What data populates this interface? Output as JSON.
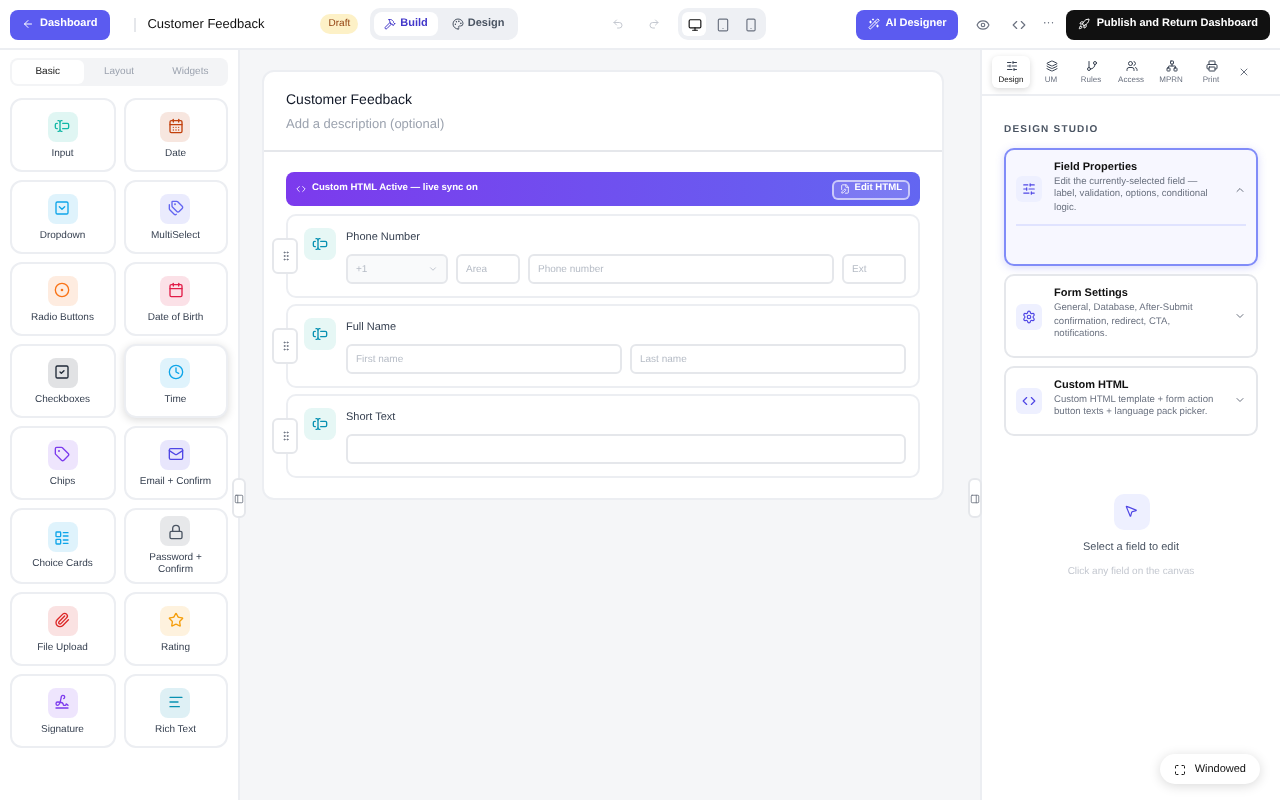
{
  "topbar": {
    "back_button": "Dashboard",
    "title": "Customer Feedback",
    "status_badge": "Draft",
    "mode_tabs": [
      {
        "label": "Build",
        "selected": true
      },
      {
        "label": "Design",
        "selected": false
      }
    ],
    "devices": [
      {
        "kind": "desktop",
        "selected": true
      },
      {
        "kind": "tablet",
        "selected": false
      },
      {
        "kind": "phone",
        "selected": false
      }
    ],
    "ai_button": "AI Designer",
    "more": "···",
    "publish_button": "Publish and Return Dashboard"
  },
  "palette": {
    "tabs": [
      {
        "label": "Basic",
        "selected": true
      },
      {
        "label": "Layout",
        "selected": false
      },
      {
        "label": "Widgets",
        "selected": false
      }
    ],
    "items": [
      {
        "label": "Input",
        "kind": "input",
        "color": "#14b8a6",
        "selected": false
      },
      {
        "label": "Date",
        "kind": "date",
        "color": "#c2410c",
        "selected": false
      },
      {
        "label": "Dropdown",
        "kind": "dropdown",
        "color": "#0ea5e9",
        "selected": false
      },
      {
        "label": "MultiSelect",
        "kind": "tags",
        "color": "#6366f1",
        "selected": false
      },
      {
        "label": "Radio Buttons",
        "kind": "radio",
        "color": "#f97316",
        "selected": false
      },
      {
        "label": "Date of Birth",
        "kind": "calendar",
        "color": "#e11d48",
        "selected": false
      },
      {
        "label": "Checkboxes",
        "kind": "checkbox",
        "color": "#1f2937",
        "selected": false
      },
      {
        "label": "Time",
        "kind": "time",
        "color": "#0ea5e9",
        "selected": true
      },
      {
        "label": "Chips",
        "kind": "chips",
        "color": "#7c3aed",
        "selected": false
      },
      {
        "label": "Email + Confirm",
        "kind": "email",
        "color": "#4f46e5",
        "selected": false
      },
      {
        "label": "Choice Cards",
        "kind": "cards",
        "color": "#0ea5e9",
        "selected": false
      },
      {
        "label": "Password + Confirm",
        "kind": "lock",
        "color": "#4b5563",
        "selected": false
      },
      {
        "label": "File Upload",
        "kind": "file",
        "color": "#dc2626",
        "selected": false
      },
      {
        "label": "Rating",
        "kind": "star",
        "color": "#f59e0b",
        "selected": false
      },
      {
        "label": "Signature",
        "kind": "signature",
        "color": "#7c3aed",
        "selected": false
      },
      {
        "label": "Rich Text",
        "kind": "richtext",
        "color": "#0891b2",
        "selected": false
      }
    ]
  },
  "canvas": {
    "form_title": "Customer Feedback",
    "description_placeholder": "Add a description (optional)",
    "banner": {
      "text": "Custom HTML Active — live sync on",
      "button": "Edit HTML"
    },
    "fields": [
      {
        "label": "Phone Number",
        "inputs": [
          {
            "kind": "select",
            "placeholder": "+1"
          },
          {
            "kind": "text",
            "placeholder": "Area"
          },
          {
            "kind": "wide",
            "placeholder": "Phone number"
          },
          {
            "kind": "text",
            "placeholder": "Ext"
          }
        ]
      },
      {
        "label": "Full Name",
        "inputs": [
          {
            "kind": "wide",
            "placeholder": "First name"
          },
          {
            "kind": "wide",
            "placeholder": "Last name"
          }
        ]
      },
      {
        "label": "Short Text",
        "inputs": [
          {
            "kind": "wide"
          }
        ]
      }
    ]
  },
  "panel": {
    "tabs": [
      {
        "label": "Design",
        "kind": "sliders",
        "selected": true
      },
      {
        "label": "UM",
        "kind": "stack",
        "selected": false
      },
      {
        "label": "Rules",
        "kind": "branch",
        "selected": false
      },
      {
        "label": "Access",
        "kind": "users",
        "selected": false
      },
      {
        "label": "MPRN",
        "kind": "network",
        "selected": false
      },
      {
        "label": "Print",
        "kind": "print",
        "selected": false
      }
    ],
    "heading": "DESIGN STUDIO",
    "sections": [
      {
        "title": "Field Properties",
        "description": "Edit the currently-selected field — label, validation, options, conditional logic.",
        "kind": "sliders",
        "expanded": true
      },
      {
        "title": "Form Settings",
        "description": "General, Database, After-Submit confirmation, redirect, CTA, notifications.",
        "kind": "gear",
        "expanded": false
      },
      {
        "title": "Custom HTML",
        "description": "Custom HTML template + form action button texts + language pack picker.",
        "kind": "code",
        "expanded": false
      }
    ],
    "empty_title": "Select a field to edit",
    "empty_hint": "Click any field on the canvas"
  },
  "windowed_button": "Windowed"
}
